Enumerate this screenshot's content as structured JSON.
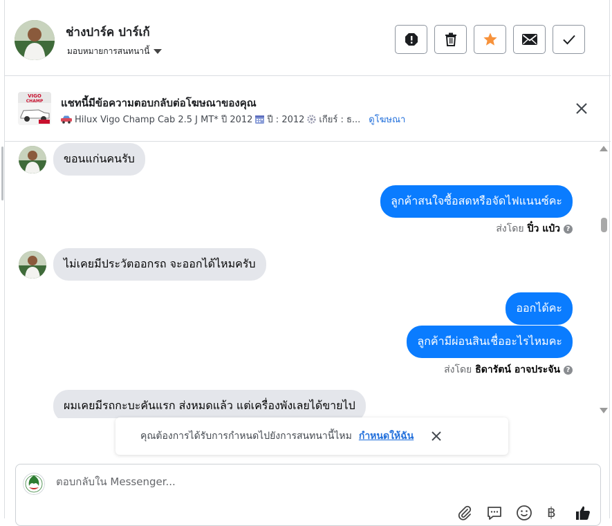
{
  "header": {
    "name": "ช่างปาร์ค ปาร์เก้",
    "assign_label": "มอบหมายการสนทนานี้",
    "buttons": [
      {
        "icon": "alert-icon"
      },
      {
        "icon": "trash-icon"
      },
      {
        "icon": "star-icon",
        "color": "#f7923b"
      },
      {
        "icon": "envelope-icon"
      },
      {
        "icon": "check-icon"
      }
    ]
  },
  "ad": {
    "title": "แชทนี้มีข้อความตอบกลับต่อโฆษณาของคุณ",
    "detail": "Hilux Vigo Champ Cab 2.5 J MT* ปี 2012",
    "year": "ปี : 2012",
    "gear": "เกียร์ : ธ...",
    "link": "ดูโฆษณา",
    "thumb_text": "VIGO CHAMP"
  },
  "messages": {
    "m1": "ขอนแก่นคนรับ",
    "m2": "ลูกค้าสนใจซื้อสดหรือจัดไฟแนนซ์คะ",
    "sent_prefix": "ส่งโดย",
    "m2_sender": "ปิ๋ว แป๋ว",
    "m3": "ไม่เคยมีประวัตออกรถ จะออกได้ไหมครับ",
    "m4": "ออกได้คะ",
    "m5": "ลูกค้ามีผ่อนสินเชื่ออะไรไหมคะ",
    "m5_sender": "ธิดารัตน์ อาจประจัน",
    "m6": "ผมเคยมีรถกะบะคันแรก ส่งหมดแล้ว  แต่เครื่องพังเลยได้ขายไป"
  },
  "toast": {
    "text": "คุณต้องการได้รับการกำหนดไปยังการสนทนานี้ไหม",
    "action": "กำหนดให้ฉัน"
  },
  "composer": {
    "placeholder": "ตอบกลับใน Messenger...",
    "icons": [
      "attachment-icon",
      "saved-reply-icon",
      "emoji-icon",
      "baht-icon",
      "like-icon"
    ],
    "baht_symbol": "฿"
  },
  "colors": {
    "accent": "#0a7cff",
    "link": "#216fdb",
    "incoming_bubble": "#e4e6eb"
  }
}
